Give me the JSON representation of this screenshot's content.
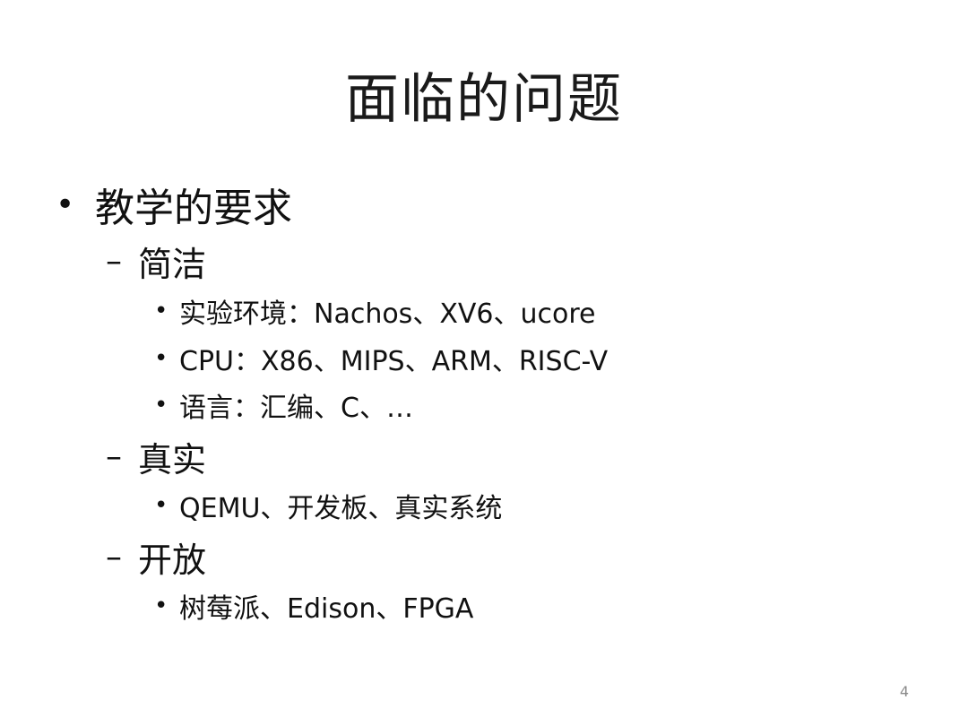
{
  "slide": {
    "title": "面临的问题",
    "page_number": "4",
    "bullets": [
      {
        "level": 1,
        "marker": "•",
        "text": "教学的要求"
      },
      {
        "level": 2,
        "marker": "–",
        "text": "简洁"
      },
      {
        "level": 3,
        "marker": "•",
        "text": "实验环境：Nachos、XV6、ucore"
      },
      {
        "level": 3,
        "marker": "•",
        "text": "CPU：X86、MIPS、ARM、RISC-V"
      },
      {
        "level": 3,
        "marker": "•",
        "text": "语言：汇编、C、…"
      },
      {
        "level": 2,
        "marker": "–",
        "text": "真实"
      },
      {
        "level": 3,
        "marker": "•",
        "text": "QEMU、开发板、真实系统"
      },
      {
        "level": 2,
        "marker": "–",
        "text": "开放"
      },
      {
        "level": 3,
        "marker": "•",
        "text": "树莓派、Edison、FPGA"
      }
    ]
  }
}
